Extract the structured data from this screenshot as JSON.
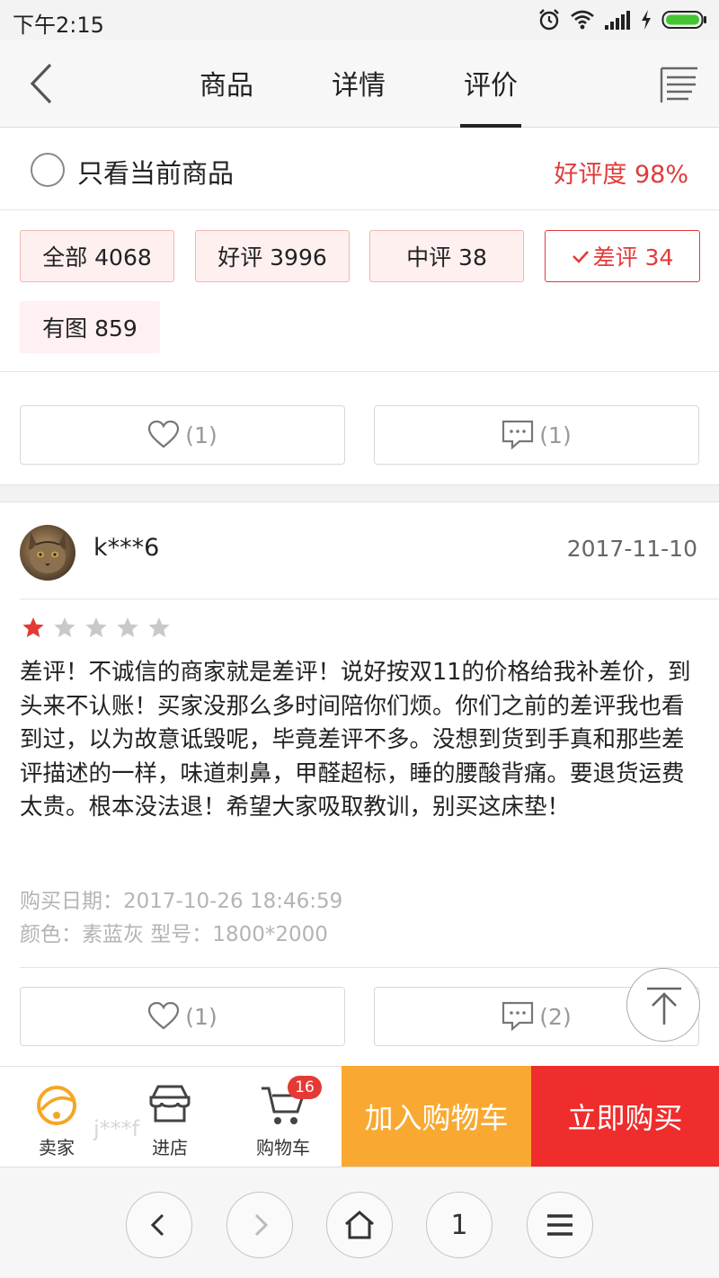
{
  "status_bar": {
    "time": "下午2:15",
    "icons": [
      "alarm-icon",
      "wifi-icon",
      "signal-icon",
      "charging-icon",
      "battery-icon"
    ]
  },
  "nav": {
    "tabs": [
      {
        "label": "商品",
        "active": false
      },
      {
        "label": "详情",
        "active": false
      },
      {
        "label": "评价",
        "active": true
      }
    ]
  },
  "filter": {
    "only_current_label": "只看当前商品",
    "positive_rate": "好评度 98%"
  },
  "chips": [
    {
      "label": "全部  4068",
      "selected": false
    },
    {
      "label": "好评  3996",
      "selected": false
    },
    {
      "label": "中评  38",
      "selected": false
    },
    {
      "label": "差评 34",
      "selected": true
    },
    {
      "label": "有图  859",
      "selected": false
    }
  ],
  "top_actions": {
    "like_count": "(1)",
    "comment_count": "(1)"
  },
  "review": {
    "username": "k***6",
    "date": "2017-11-10",
    "rating": 1,
    "max_rating": 5,
    "text": "差评！不诚信的商家就是差评！说好按双11的价格给我补差价，到头来不认账！买家没那么多时间陪你们烦。你们之前的差评我也看到过，以为故意诋毁呢，毕竟差评不多。没想到货到手真和那些差评描述的一样，味道刺鼻，甲醛超标，睡的腰酸背痛。要退货运费太贵。根本没法退！希望大家吸取教训，别买这床垫！",
    "purchase_date": "购买日期：2017-10-26 18:46:59",
    "spec": "颜色：素蓝灰 型号：1800*2000",
    "like_count": "(1)",
    "comment_count": "(2)"
  },
  "bottom_bar": {
    "seller_label": "卖家",
    "store_label": "进店",
    "cart_label": "购物车",
    "cart_badge": "16",
    "ghost_user": "j***f",
    "add_to_cart": "加入购物车",
    "buy_now": "立即购买"
  },
  "browser_bar": {
    "tab_count": "1"
  },
  "colors": {
    "accent_red": "#e23b3b",
    "cart_orange": "#f9a931",
    "buy_red": "#ef2d2d"
  }
}
